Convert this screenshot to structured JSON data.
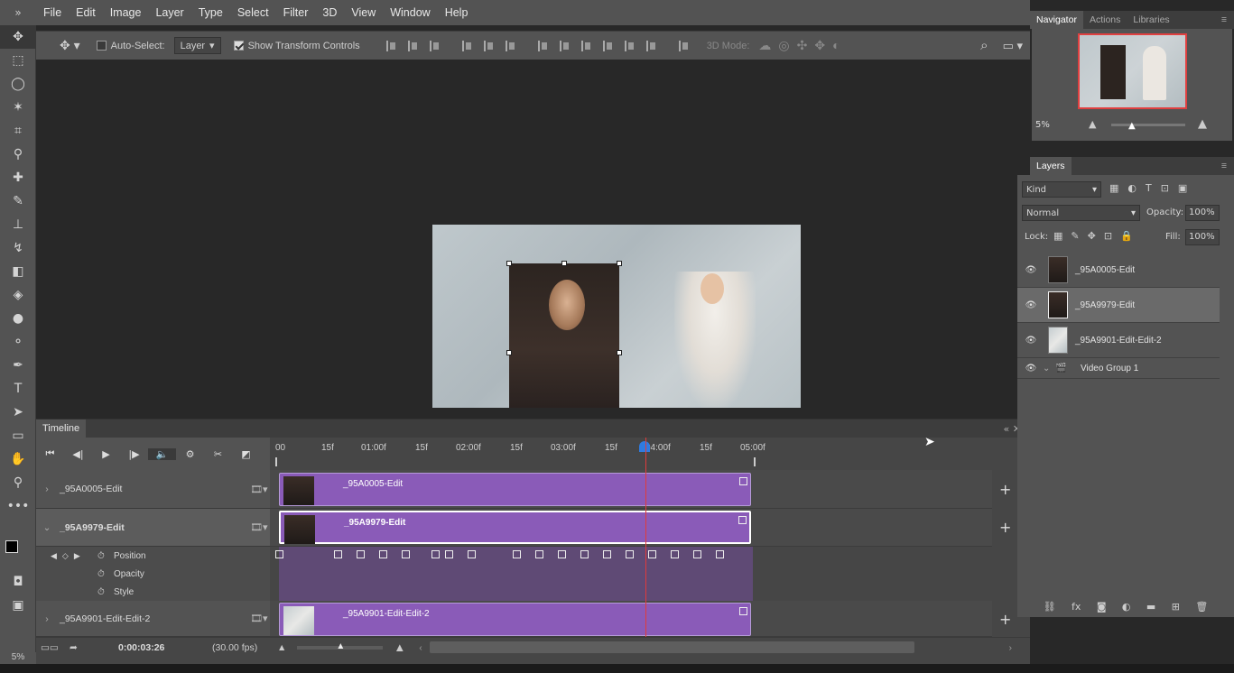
{
  "menu": [
    "File",
    "Edit",
    "Image",
    "Layer",
    "Type",
    "Select",
    "Filter",
    "3D",
    "View",
    "Window",
    "Help"
  ],
  "options": {
    "auto_select_label": "Auto-Select:",
    "auto_select_value": "Layer",
    "show_transform_label": "Show Transform Controls",
    "mode_3d_label": "3D Mode:"
  },
  "timeline": {
    "title": "Timeline",
    "tracks": [
      {
        "name": "_95A0005-Edit",
        "clip": "_95A0005-Edit"
      },
      {
        "name": "_95A9979-Edit",
        "clip": "_95A9979-Edit"
      },
      {
        "name": "_95A9901-Edit-Edit-2",
        "clip": "_95A9901-Edit-Edit-2"
      }
    ],
    "properties": [
      "Position",
      "Opacity",
      "Style"
    ],
    "ruler": [
      "00",
      "15f",
      "01:00f",
      "15f",
      "02:00f",
      "15f",
      "03:00f",
      "15f",
      "04:00f",
      "15f",
      "05:00f"
    ],
    "current_time": "0:00:03:26",
    "fps": "(30.00 fps)"
  },
  "status": {
    "zoom": "5%"
  },
  "navigator": {
    "tabs": [
      "Navigator",
      "Actions",
      "Libraries"
    ],
    "zoom": "5%"
  },
  "layers": {
    "title": "Layers",
    "kind_label": "Kind",
    "blend_mode": "Normal",
    "opacity_label": "Opacity:",
    "opacity_value": "100%",
    "lock_label": "Lock:",
    "fill_label": "Fill:",
    "fill_value": "100%",
    "items": [
      {
        "name": "_95A0005-Edit"
      },
      {
        "name": "_95A9979-Edit"
      },
      {
        "name": "_95A9901-Edit-Edit-2"
      },
      {
        "name": "Video Group 1"
      }
    ]
  },
  "colors": {
    "clip": "#8a5bb8",
    "playhead": "#e03b3b",
    "accent": "#2f7be0"
  }
}
